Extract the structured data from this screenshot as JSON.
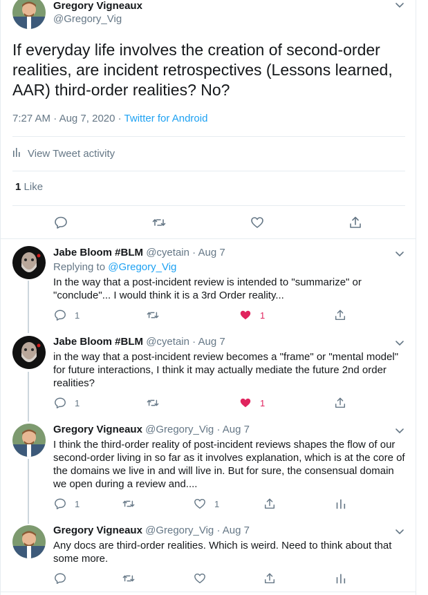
{
  "main_tweet": {
    "author_name": "Gregory Vigneaux",
    "author_handle": "@Gregory_Vig",
    "text": "If everyday life involves the creation of second-order realities, are incident retrospectives (Lessons learned, AAR) third-order realities? No?",
    "time": "7:27 AM",
    "date": "Aug 7, 2020",
    "separator": "·",
    "source": "Twitter for Android",
    "activity_label": "View Tweet activity",
    "like_count": "1",
    "like_label": "Like"
  },
  "replies": [
    {
      "author_name": "Jabe Bloom #BLM",
      "author_handle": "@cyetain",
      "date": "· Aug 7",
      "replying_to_label": "Replying to",
      "replying_to_handle": "@Gregory_Vig",
      "text": "In the way that a post-incident review is intended to \"summarize\" or \"conclude\"... I would think it is a 3rd Order reality...",
      "reply_count": "1",
      "like_count": "1",
      "liked": true
    },
    {
      "author_name": "Jabe Bloom #BLM",
      "author_handle": "@cyetain",
      "date": "· Aug 7",
      "text": "in the way that a post-incident review becomes a \"frame\" or \"mental model\" for future interactions, I think it may actually mediate the future 2nd order realities?",
      "reply_count": "1",
      "like_count": "1",
      "liked": true
    },
    {
      "author_name": "Gregory Vigneaux",
      "author_handle": "@Gregory_Vig",
      "date": "· Aug 7",
      "text": "I think the third-order reality of post-incident reviews shapes the flow of our second-order living in so far as it involves explanation, which is at the core of the domains we live in and will live in. But for sure, the consensual domain we open during a review and....",
      "reply_count": "1",
      "like_count": "1",
      "liked": false
    },
    {
      "author_name": "Gregory Vigneaux",
      "author_handle": "@Gregory_Vig",
      "date": "· Aug 7",
      "text": "Any docs are third-order realities. Which is weird. Need to think about that some more.",
      "liked": false
    }
  ],
  "colors": {
    "accent": "#1da1f2",
    "like": "#e0245e",
    "muted": "#657786",
    "divider": "#e6ecf0"
  }
}
